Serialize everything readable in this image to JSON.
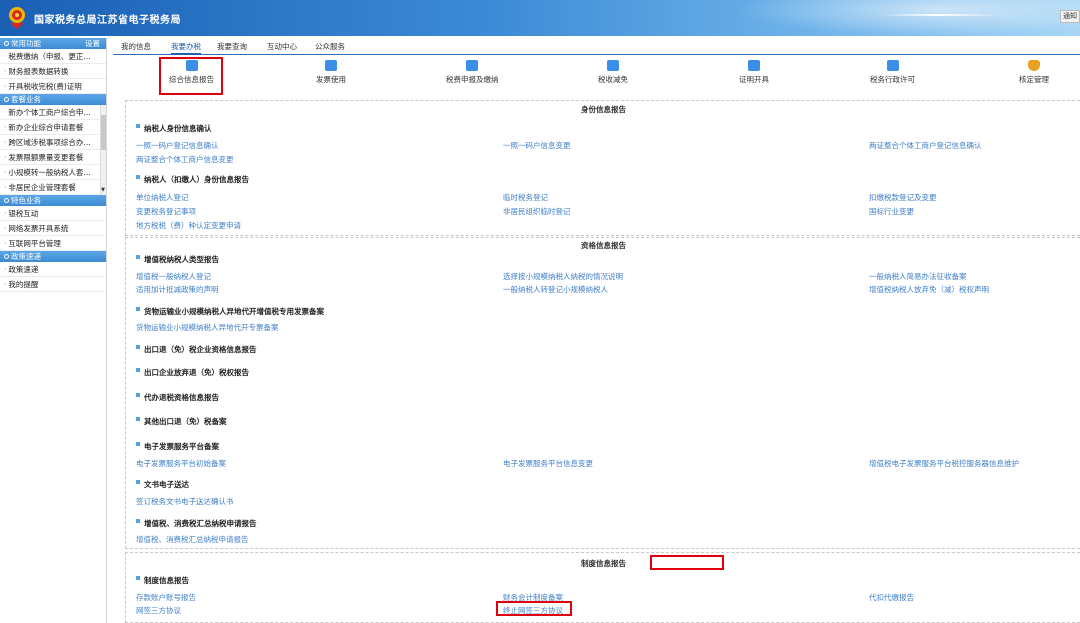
{
  "header": {
    "title": "国家税务总局江苏省电子税务局",
    "right_link": "通知"
  },
  "sidebar": {
    "sections": [
      {
        "title": "常用功能",
        "action": "设置",
        "items": [
          "税费缴纳（申报、更正…",
          "财务报表数据转换",
          "开具税收完税(费)证明"
        ]
      },
      {
        "title": "套餐业务",
        "items": [
          "新办个体工商户综合申…",
          "新办企业综合申请套餐",
          "跨区域涉税事项综合办…",
          "发票限额票量变更套餐",
          "小规模转一般纳税人套…",
          "非居民企业管理套餐"
        ]
      },
      {
        "title": "特色业务",
        "items": [
          "银税互动",
          "网络发票开具系统",
          "互联网平台管理"
        ]
      },
      {
        "title": "政策速递",
        "items": [
          "政策速递",
          "我的提醒"
        ]
      }
    ]
  },
  "nav": {
    "tabs": [
      "我的信息",
      "我要办税",
      "我要查询",
      "互动中心",
      "公众服务"
    ],
    "active": "我要办税"
  },
  "toolbar": {
    "items": [
      {
        "label": "综合信息报告",
        "icon": "monitor-icon",
        "color": "#3a8ee6"
      },
      {
        "label": "发票使用",
        "icon": "invoice-icon",
        "color": "#3a8ee6"
      },
      {
        "label": "税费申报及缴纳",
        "icon": "desktop-icon",
        "color": "#3a8ee6"
      },
      {
        "label": "税收减免",
        "icon": "calculator-icon",
        "color": "#3a8ee6"
      },
      {
        "label": "证明开具",
        "icon": "certificate-icon",
        "color": "#3a8ee6"
      },
      {
        "label": "税务行政许可",
        "icon": "license-icon",
        "color": "#3a8ee6"
      },
      {
        "label": "核定管理",
        "icon": "shield-icon",
        "color": "#e8a020"
      }
    ]
  },
  "content": {
    "identity": {
      "title": "身份信息报告",
      "g1": {
        "title": "纳税人身份信息确认",
        "links": [
          "一照一码户登记信息确认",
          "一照一码户信息变更",
          "两证整合个体工商户登记信息确认",
          "两证整合个体工商户信息变更"
        ]
      },
      "g2": {
        "title": "纳税人（扣缴人）身份信息报告",
        "links": [
          "单位纳税人登记",
          "临时税务登记",
          "扣缴税款登记及变更",
          "变更税务登记事项",
          "非居民组织临时登记",
          "国标行业变更",
          "地方税税（费）种认定变更申请"
        ]
      }
    },
    "qualification": {
      "title": "资格信息报告",
      "g1": {
        "title": "增值税纳税人类型报告",
        "links": [
          "增值税一般纳税人登记",
          "选择按小规模纳税人纳税的情况说明",
          "一般纳税人简易办法征收备案",
          "适用加计抵减政策的声明",
          "一般纳税人转登记小规模纳税人",
          "增值税纳税人放弃免（减）税权声明"
        ]
      },
      "g2": {
        "title": "货物运输业小规模纳税人异地代开增值税专用发票备案",
        "links": [
          "货物运输业小规模纳税人异地代开专票备案"
        ]
      },
      "g3": {
        "title": "出口退（免）税企业资格信息报告"
      },
      "g4": {
        "title": "出口企业放弃退（免）税权报告"
      },
      "g5": {
        "title": "代办退税资格信息报告"
      },
      "g6": {
        "title": "其他出口退（免）税备案"
      },
      "g7": {
        "title": "电子发票服务平台备案",
        "links": [
          "电子发票服务平台初始备案",
          "电子发票服务平台信息变更",
          "增值税电子发票服务平台税控服务器信息维护"
        ]
      },
      "g8": {
        "title": "文书电子送达",
        "links": [
          "签订税务文书电子送达确认书"
        ]
      },
      "g9": {
        "title": "增值税、消费税汇总纳税申请报告",
        "links": [
          "增值税、消费税汇总纳税申请报告"
        ]
      }
    },
    "system": {
      "title": "制度信息报告",
      "g1": {
        "title": "制度信息报告",
        "links": [
          "存款账户账号报告",
          "财务会计制度备案",
          "代扣代缴报告",
          "网签三方协议",
          "终止网签三方协议"
        ]
      }
    }
  }
}
